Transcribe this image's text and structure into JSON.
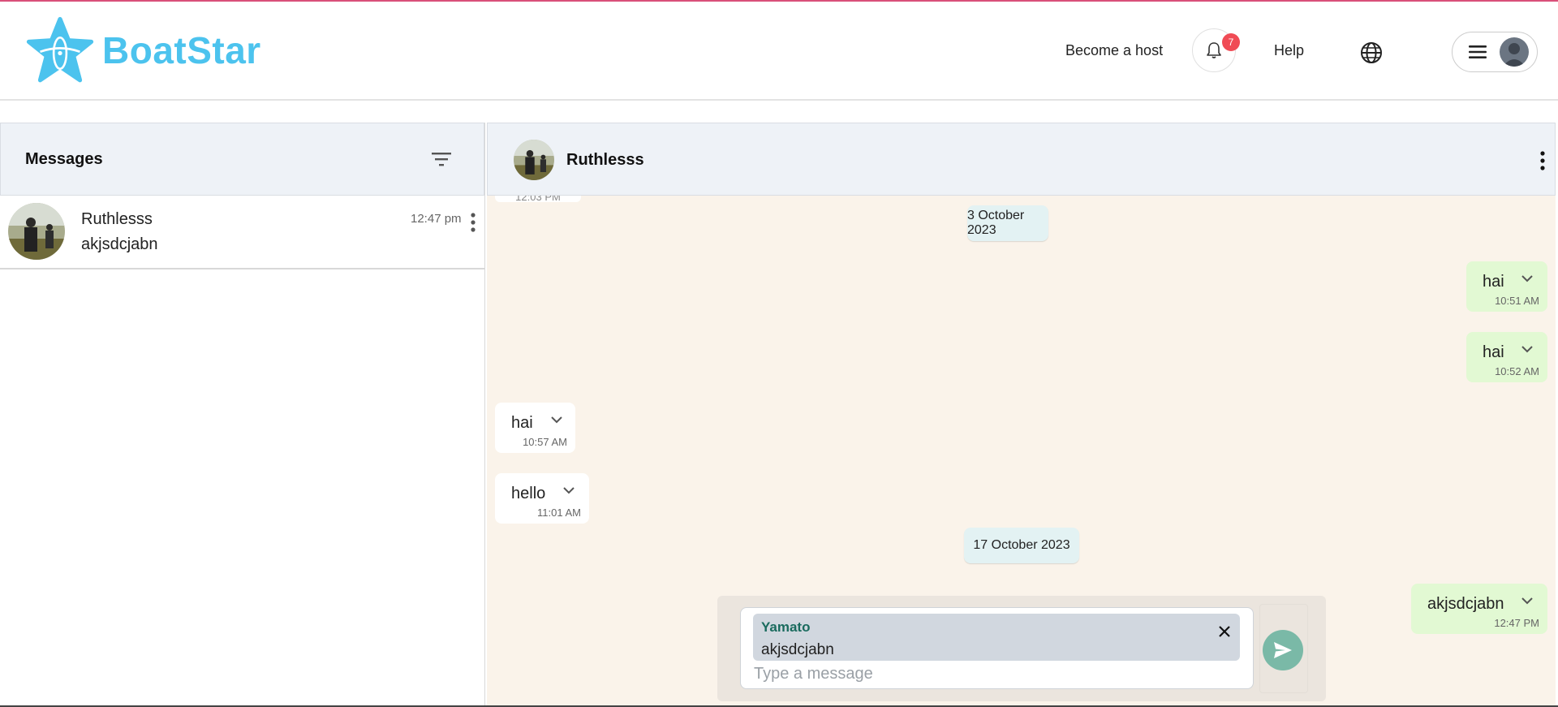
{
  "brand": {
    "name": "BoatStar",
    "color": "#4cc3ee"
  },
  "nav": {
    "become_host": "Become a host",
    "notifications_count": "7",
    "help": "Help"
  },
  "sidebar": {
    "title": "Messages",
    "conversations": [
      {
        "name": "Ruthlesss",
        "last_message": "akjsdcjabn",
        "time": "12:47 pm"
      }
    ]
  },
  "chat": {
    "contact_name": "Ruthlesss",
    "partial_time": "12:03 PM",
    "dates": [
      "3 October 2023",
      "17 October 2023"
    ],
    "messages": [
      {
        "direction": "out",
        "text": "hai",
        "time": "10:51 AM"
      },
      {
        "direction": "out",
        "text": "hai",
        "time": "10:52 AM"
      },
      {
        "direction": "in",
        "text": "hai",
        "time": "10:57 AM"
      },
      {
        "direction": "in",
        "text": "hello",
        "time": "11:01 AM"
      },
      {
        "direction": "out",
        "text": "akjsdcjabn",
        "time": "12:47 PM"
      }
    ]
  },
  "composer": {
    "reply_to_name": "Yamato",
    "reply_to_text": "akjsdcjabn",
    "placeholder": "Type a message"
  },
  "colors": {
    "accent_line": "#d9507a",
    "chat_background": "#faf3ea",
    "outgoing_bubble": "#e2f9d3",
    "badge": "#f04b55",
    "send_button": "#7ab9a7"
  }
}
